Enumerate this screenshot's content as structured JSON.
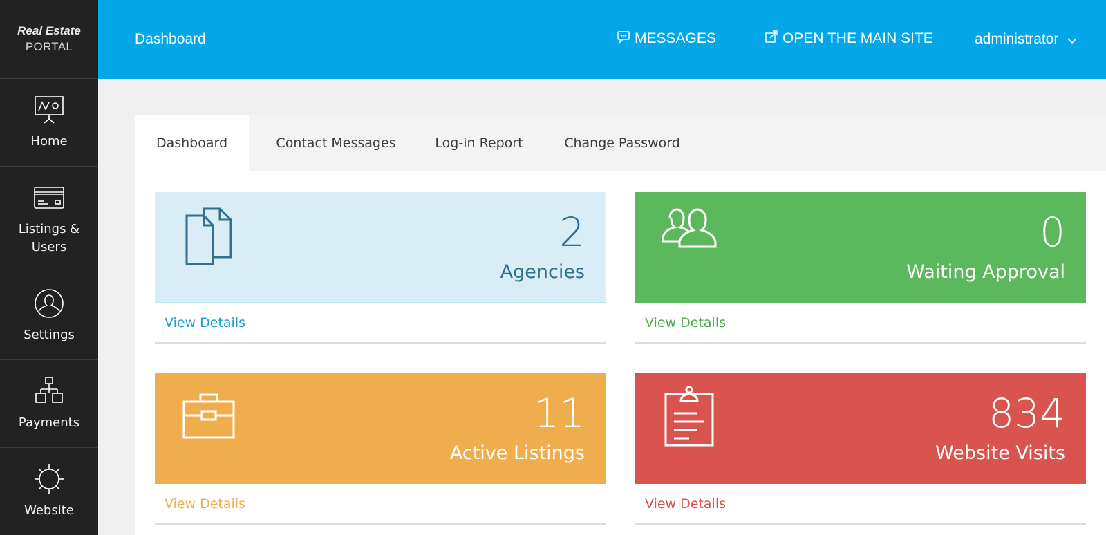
{
  "logo": {
    "line1": "Real Estate",
    "line2": "PORTAL"
  },
  "sidebar": {
    "items": [
      {
        "label": "Home",
        "icon": "presentation-board-icon"
      },
      {
        "label": "Listings & Users",
        "icon": "credit-card-icon"
      },
      {
        "label": "Settings",
        "icon": "user-circle-icon"
      },
      {
        "label": "Payments",
        "icon": "sitemap-icon"
      },
      {
        "label": "Website",
        "icon": "gear-icon"
      }
    ]
  },
  "topbar": {
    "title": "Dashboard",
    "messages_label": "MESSAGES",
    "open_site_label": "OPEN THE MAIN SITE",
    "user_label": "administrator",
    "background": "#03a6e7"
  },
  "tabs": [
    {
      "label": "Dashboard",
      "active": true
    },
    {
      "label": "Contact Messages",
      "active": false
    },
    {
      "label": "Log-in Report",
      "active": false
    },
    {
      "label": "Change Password",
      "active": false
    }
  ],
  "cards": [
    {
      "value": "2",
      "label": "Agencies",
      "link": "View Details",
      "icon": "documents-icon",
      "bg": "#d9edf7",
      "fg": "#31708f",
      "link_color": "#1a9fd9"
    },
    {
      "value": "0",
      "label": "Waiting Approval",
      "link": "View Details",
      "icon": "users-icon",
      "bg": "#5cb85c",
      "fg": "#ffffff",
      "link_color": "#4cae4c"
    },
    {
      "value": "11",
      "label": "Active Listings",
      "link": "View Details",
      "icon": "briefcase-icon",
      "bg": "#f0ad4e",
      "fg": "#ffffff",
      "link_color": "#f0ad4e"
    },
    {
      "value": "834",
      "label": "Website Visits",
      "link": "View Details",
      "icon": "clipboard-icon",
      "bg": "#d9534f",
      "fg": "#ffffff",
      "link_color": "#d9534f"
    }
  ]
}
